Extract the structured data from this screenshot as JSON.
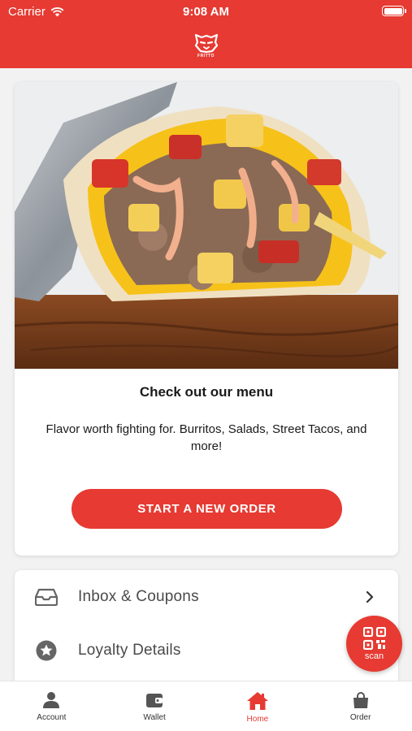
{
  "status_bar": {
    "carrier": "Carrier",
    "time": "9:08 AM",
    "wifi_icon": "wifi-icon",
    "battery_icon": "battery-full-icon"
  },
  "header": {
    "logo_icon": "tiger-head-logo-icon",
    "logo_text": "FRITTO"
  },
  "menu_card": {
    "image_icon": "burrito-photo",
    "title": "Check out our menu",
    "description": "Flavor worth fighting for. Burritos, Salads, Street Tacos, and more!",
    "button_label": "START A NEW ORDER"
  },
  "list": {
    "items": [
      {
        "label": "Inbox & Coupons",
        "icon": "inbox-tray-icon",
        "chevron": "chevron-right-icon"
      },
      {
        "label": "Loyalty Details",
        "icon": "star-circle-icon"
      }
    ]
  },
  "scan_button": {
    "label": "scan",
    "icon": "qr-code-icon"
  },
  "tab_bar": {
    "tabs": [
      {
        "label": "Account",
        "icon": "person-icon",
        "active": false
      },
      {
        "label": "Wallet",
        "icon": "wallet-icon",
        "active": false
      },
      {
        "label": "Home",
        "icon": "home-icon",
        "active": true
      },
      {
        "label": "Order",
        "icon": "shopping-bag-icon",
        "active": false
      }
    ]
  },
  "colors": {
    "brand_red": "#e63a32",
    "text_dark": "#1a1a1a",
    "icon_gray": "#666666",
    "background": "#f2f2f2"
  }
}
